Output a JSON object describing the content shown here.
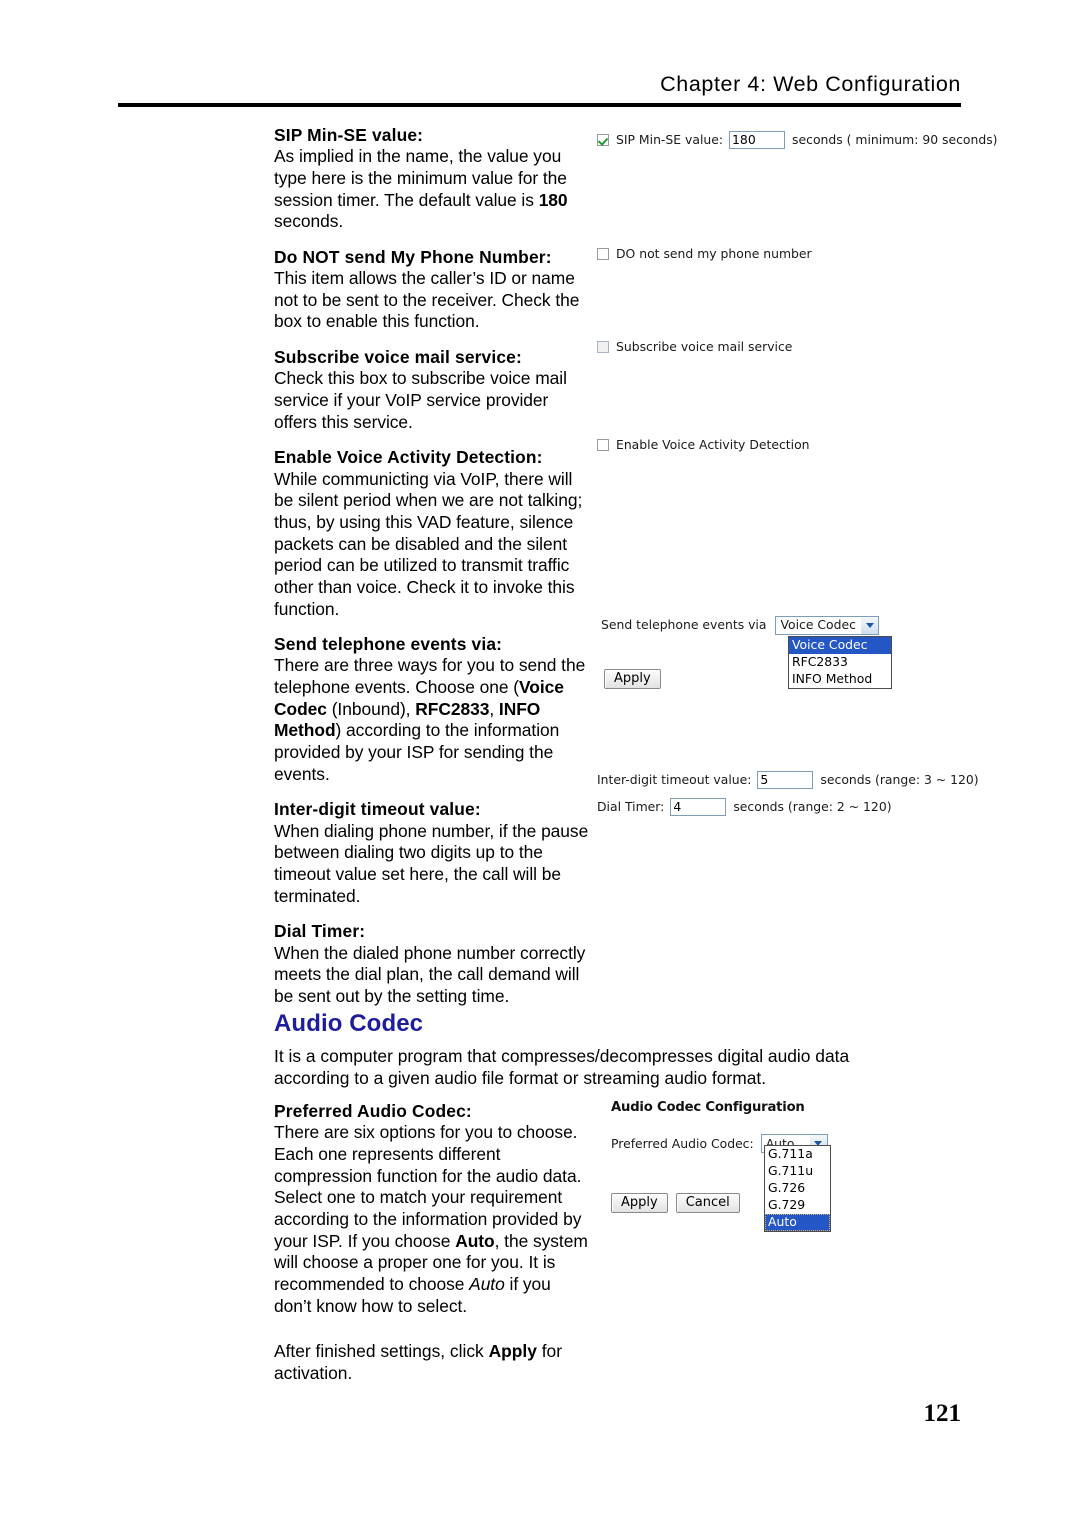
{
  "header": {
    "chapter": "Chapter 4: Web Configuration"
  },
  "page_number": "121",
  "sections": [
    {
      "heading": "SIP Min-SE value:",
      "body": "As implied in the name, the value you type here is the minimum value for the session timer. The default value is 180 seconds."
    },
    {
      "heading": "Do NOT send My Phone Number:",
      "body": "This item allows the caller’s ID or name not to be sent to the receiver. Check the box to enable this function."
    },
    {
      "heading": "Subscribe voice mail service:",
      "body": "Check this box to subscribe voice mail service if your VoIP service provider offers this service."
    },
    {
      "heading": "Enable Voice Activity Detection:",
      "body": "While communicting via VoIP, there will be silent period when we are not talking; thus, by using this VAD feature, silence packets can be disabled and the silent period can be utilized to transmit traffic other than voice. Check it to invoke this function."
    },
    {
      "heading": "Send telephone events via:",
      "body": "There are three ways for you to send the telephone events. Choose one (Voice Codec (Inbound), RFC2833, INFO Method) according to the information provided by your ISP for sending the events."
    },
    {
      "heading": "Inter-digit timeout value:",
      "body": "When dialing phone number, if the pause between dialing two digits up to the timeout value set here, the call will be terminated."
    },
    {
      "heading": "Dial Timer:",
      "body": "When the dialed phone number correctly meets the dial plan, the call demand will be sent out by the setting time."
    }
  ],
  "audio_codec": {
    "heading": "Audio Codec",
    "intro": "It is a computer program that compresses/decompresses digital audio data according to a given audio file format or streaming audio format.",
    "preferred_heading": "Preferred Audio Codec:",
    "preferred_body": "There are six options for you to choose. Each one represents different compression function for the audio data. Select one to match your requirement according to the information provided by your ISP. If you choose Auto, the system will choose a proper one for you. It is recommended to choose Auto if you don’t know how to select.",
    "after_settings": "After finished settings, click Apply for activation."
  },
  "ui": {
    "sip_min_se": {
      "checkbox_checked": true,
      "label": "SIP Min-SE value:",
      "value": "180",
      "suffix": "seconds ( minimum: 90 seconds)"
    },
    "do_not_send": {
      "checkbox_checked": false,
      "label": "DO not send my phone number"
    },
    "subscribe_voicemail": {
      "checkbox_checked": false,
      "label": "Subscribe voice mail service"
    },
    "enable_vad": {
      "checkbox_checked": false,
      "label": "Enable Voice Activity Detection"
    },
    "send_events": {
      "label": "Send telephone events via",
      "selected": "Voice Codec",
      "options": [
        "Voice Codec",
        "RFC2833",
        "INFO Method"
      ],
      "apply_label": "Apply"
    },
    "timers": {
      "interdigit_label": "Inter-digit timeout value:",
      "interdigit_value": "5",
      "interdigit_suffix": "seconds (range: 3 ~ 120)",
      "dialtimer_label": "Dial Timer:",
      "dialtimer_value": "4",
      "dialtimer_suffix": "seconds (range: 2 ~ 120)"
    },
    "audio_panel": {
      "title": "Audio Codec Configuration",
      "preferred_label": "Preferred Audio Codec:",
      "selected": "Auto",
      "options": [
        "G.711a",
        "G.711u",
        "G.726",
        "G.729",
        "Auto"
      ],
      "apply_label": "Apply",
      "cancel_label": "Cancel"
    }
  },
  "colors": {
    "heading_blue": "#1d1d9e",
    "highlight_blue": "#2456c6",
    "check_green": "#1f9a34"
  }
}
